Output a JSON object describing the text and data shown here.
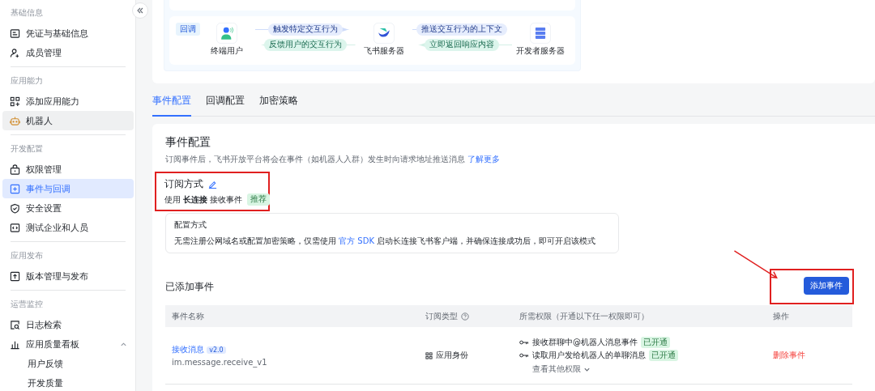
{
  "sidebar": {
    "sections": [
      {
        "title": "基础信息",
        "items": [
          {
            "label": "凭证与基础信息",
            "kind": "card",
            "selected": false,
            "highlighted": false
          },
          {
            "label": "成员管理",
            "kind": "person",
            "selected": false,
            "highlighted": false
          }
        ]
      },
      {
        "title": "应用能力",
        "items": [
          {
            "label": "添加应用能力",
            "kind": "grid",
            "selected": false,
            "highlighted": false
          },
          {
            "label": "机器人",
            "kind": "robot",
            "selected": false,
            "highlighted": true
          }
        ]
      },
      {
        "title": "开发配置",
        "items": [
          {
            "label": "权限管理",
            "kind": "lock",
            "selected": false,
            "highlighted": false
          },
          {
            "label": "事件与回调",
            "kind": "plusbox",
            "selected": true,
            "highlighted": false
          },
          {
            "label": "安全设置",
            "kind": "shield",
            "selected": false,
            "highlighted": false
          },
          {
            "label": "测试企业和人员",
            "kind": "code",
            "selected": false,
            "highlighted": false
          }
        ]
      },
      {
        "title": "应用发布",
        "items": [
          {
            "label": "版本管理与发布",
            "kind": "upload",
            "selected": false,
            "highlighted": false
          }
        ]
      },
      {
        "title": "运营监控",
        "items": [
          {
            "label": "日志检索",
            "kind": "searchdoc",
            "selected": false,
            "highlighted": false
          },
          {
            "label": "应用质量看板",
            "kind": "chart",
            "selected": false,
            "highlighted": false,
            "expanded": true,
            "children": [
              {
                "label": "用户反馈"
              },
              {
                "label": "开发质量"
              }
            ]
          }
        ]
      }
    ]
  },
  "flow": {
    "tag": "回调",
    "nodes": [
      {
        "label": "终端用户",
        "kind": "user"
      },
      {
        "label": "飞书服务器",
        "kind": "bird"
      },
      {
        "label": "开发者服务器",
        "kind": "server"
      }
    ],
    "links": [
      [
        {
          "label": "触发特定交互行为",
          "kind": "right"
        },
        {
          "label": "反馈用户的交互行为",
          "kind": "left"
        }
      ],
      [
        {
          "label": "推送交互行为的上下文",
          "kind": "right"
        },
        {
          "label": "立即返回响应内容",
          "kind": "left"
        }
      ]
    ]
  },
  "tabs": [
    {
      "label": "事件配置",
      "selected": true
    },
    {
      "label": "回调配置",
      "selected": false
    },
    {
      "label": "加密策略",
      "selected": false
    }
  ],
  "section": {
    "title": "事件配置",
    "description": "订阅事件后，飞书开放平台将会在事件（如机器人入群）发生时向请求地址推送消息",
    "link": "了解更多"
  },
  "subscription": {
    "title": "订阅方式",
    "mode": "使用 **长连接** 接收事件",
    "tag": "推荐"
  },
  "config": {
    "title": "配置方式",
    "text_before": "无需注册公网域名或配置加密策略，仅需使用 ",
    "link": "官方 SDK",
    "text_after": " 启动长连接飞书客户端，并确保连接成功后，即可开启该模式"
  },
  "events": {
    "title": "已添加事件",
    "add_button": "添加事件",
    "columns": [
      {
        "label": "事件名称",
        "help": false
      },
      {
        "label": "订阅类型",
        "help": true
      },
      {
        "label": "所需权限（开通以下任一权限即可）",
        "help": false
      },
      {
        "label": "操作",
        "help": false
      }
    ],
    "rows": [
      {
        "name": "接收消息",
        "version": "v2.0",
        "code": "im.message.receive_v1",
        "type": "应用身份",
        "permissions": [
          {
            "label": "接收群聊中@机器人消息事件",
            "status": "已开通"
          },
          {
            "label": "读取用户发给机器人的单聊消息",
            "status": "已开通"
          }
        ],
        "more": "查看其他权限",
        "action": "删除事件"
      }
    ]
  }
}
